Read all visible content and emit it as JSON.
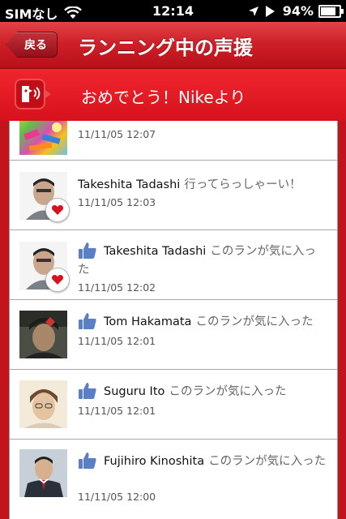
{
  "status_bar": {
    "carrier": "SIMなし",
    "time": "12:14",
    "battery": "94%"
  },
  "nav": {
    "back_label": "戻る",
    "title": "ランニング中の声援"
  },
  "banner": {
    "text": "おめでとう！Nikeより"
  },
  "colors": {
    "brand_red": "#c4141b",
    "banner_red": "#e51c25",
    "like_blue": "#5a7fc4",
    "heart_red": "#d6141d"
  },
  "feed": {
    "items": [
      {
        "type": "partial",
        "timestamp": "11/11/05 12:07"
      },
      {
        "type": "comment",
        "name": "Takeshita Tadashi",
        "text": "行ってらっしゃーい！",
        "timestamp": "11/11/05 12:03",
        "badge": "heart-icon"
      },
      {
        "type": "like",
        "name": "Takeshita Tadashi",
        "text": "このランが気に入った",
        "timestamp": "11/11/05 12:02",
        "badge": "heart-icon"
      },
      {
        "type": "like",
        "name": "Tom Hakamata",
        "text": "このランが気に入った",
        "timestamp": "11/11/05 12:01"
      },
      {
        "type": "like",
        "name": "Suguru Ito",
        "text": "このランが気に入った",
        "timestamp": "11/11/05 12:01"
      },
      {
        "type": "like",
        "name": "Fujihiro Kinoshita",
        "text": "このランが気に入った",
        "timestamp": "11/11/05 12:00"
      }
    ]
  }
}
